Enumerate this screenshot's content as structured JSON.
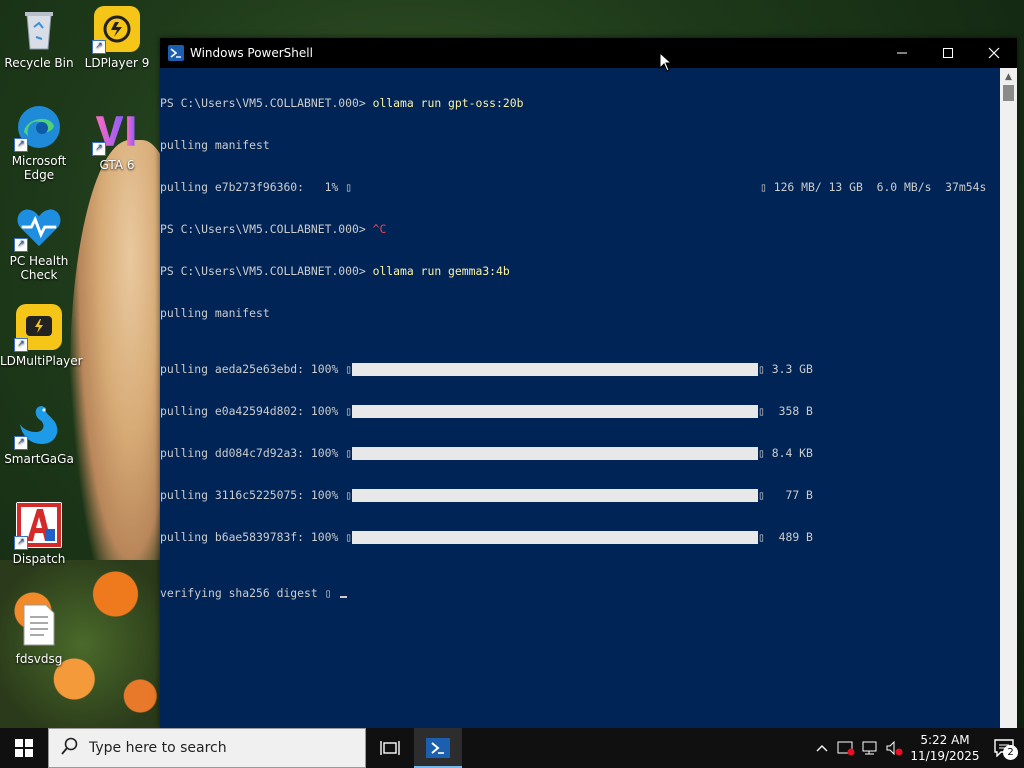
{
  "desktop": {
    "icons": [
      {
        "label": "Recycle Bin"
      },
      {
        "label": "LDPlayer 9"
      },
      {
        "label": "Microsoft Edge"
      },
      {
        "label": "GTA 6"
      },
      {
        "label": "PC Health Check"
      },
      {
        "label": "LDMultiPlayer"
      },
      {
        "label": "SmartGaGa"
      },
      {
        "label": "Dispatch"
      },
      {
        "label": "fdsvdsg"
      }
    ]
  },
  "window": {
    "title": "Windows PowerShell",
    "controls": {
      "minimize": "—",
      "maximize": "☐",
      "close": "✕"
    }
  },
  "terminal": {
    "lines": [
      {
        "prompt": "PS C:\\Users\\VM5.COLLABNET.000> ",
        "command": "ollama run gpt-oss:20b"
      },
      {
        "text": "pulling manifest"
      },
      {
        "text": "pulling e7b273f96360:   1% ▯",
        "stats": "▯ 126 MB/ 13 GB  6.0 MB/s  37m54s",
        "progress_pct": 1
      },
      {
        "prompt": "PS C:\\Users\\VM5.COLLABNET.000> ",
        "ctrlc": "^C"
      },
      {
        "prompt": "PS C:\\Users\\VM5.COLLABNET.000> ",
        "command": "ollama run gemma3:4b"
      },
      {
        "text": "pulling manifest"
      }
    ],
    "layers": [
      {
        "id": "pulling aeda25e63ebd: 100% ▯",
        "size": "▯ 3.3 GB",
        "progress_pct": 100
      },
      {
        "id": "pulling e0a42594d802: 100% ▯",
        "size": "▯  358 B",
        "progress_pct": 100
      },
      {
        "id": "pulling dd084c7d92a3: 100% ▯",
        "size": "▯ 8.4 KB",
        "progress_pct": 100
      },
      {
        "id": "pulling 3116c5225075: 100% ▯",
        "size": "▯   77 B",
        "progress_pct": 100
      },
      {
        "id": "pulling b6ae5839783f: 100% ▯",
        "size": "▯  489 B",
        "progress_pct": 100
      }
    ],
    "verifying": "verifying sha256 digest ▯ "
  },
  "taskbar": {
    "search_placeholder": "Type here to search",
    "time": "5:22 AM",
    "date": "11/19/2025",
    "notification_count": "2"
  },
  "colors": {
    "terminal_bg": "#012456",
    "terminal_fg": "#cccccc",
    "command": "#f9f1a5",
    "ctrl_c": "#e74856",
    "taskbar_bg": "#101010"
  }
}
